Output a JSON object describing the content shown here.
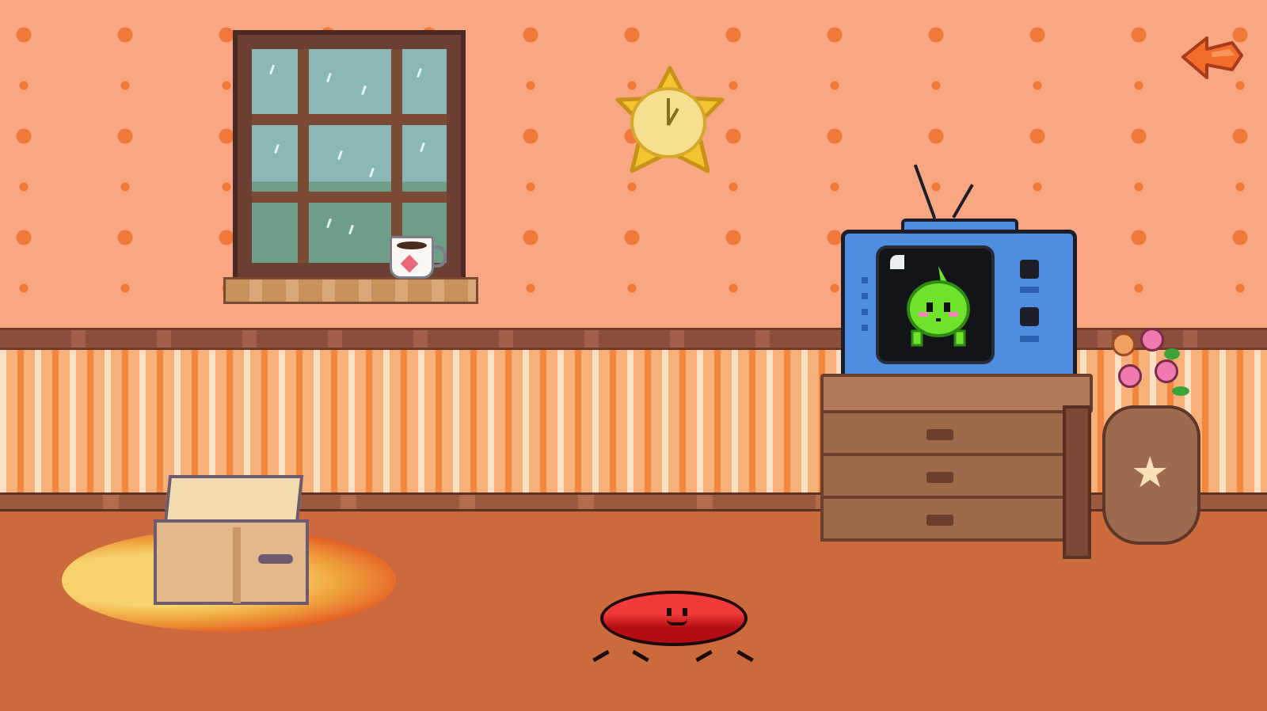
{
  "scene": {
    "name": "living-room",
    "colors": {
      "wallpaper": "#f9a683",
      "wallpaper_dots": "#f2783a",
      "floor": "#cd6a3d",
      "tv_body": "#4e8de0",
      "creature": "#6fe22e",
      "slime": "#e4141b"
    }
  },
  "icons": {
    "back": "back-arrow-icon",
    "clock": "star-clock-icon",
    "mug": "coffee-mug-icon",
    "tv": "tv-icon",
    "box": "cardboard-box-icon",
    "vase": "flower-vase-icon"
  }
}
